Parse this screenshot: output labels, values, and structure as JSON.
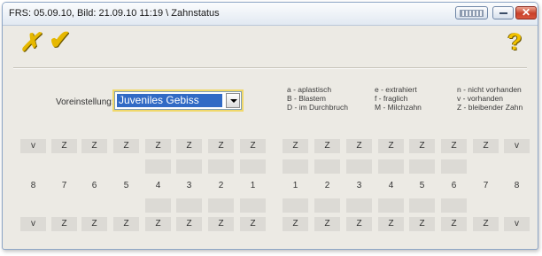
{
  "window": {
    "title": "FRS: 05.09.10,  Bild: 21.09.10  11:19 \\ Zahnstatus",
    "close_glyph": "✕"
  },
  "toolbar": {
    "cancel_icon": "✗",
    "ok_icon": "✔",
    "help_icon": "?"
  },
  "preset": {
    "label": "Voreinstellung:",
    "value": "Juveniles Gebiss"
  },
  "legend": {
    "col1": [
      "a - aplastisch",
      "B - Blastem",
      "D - im Durchbruch"
    ],
    "col2": [
      "e  - extrahiert",
      "f  - fraglich",
      "M - Milchzahn"
    ],
    "col3": [
      "n - nicht vorhanden",
      "v - vorhanden",
      "Z - bleibender Zahn"
    ]
  },
  "chart": {
    "upper_status": [
      "v",
      "Z",
      "Z",
      "Z",
      "Z",
      "Z",
      "Z",
      "Z",
      "Z",
      "Z",
      "Z",
      "Z",
      "Z",
      "Z",
      "Z",
      "v"
    ],
    "lower_status": [
      "v",
      "Z",
      "Z",
      "Z",
      "Z",
      "Z",
      "Z",
      "Z",
      "Z",
      "Z",
      "Z",
      "Z",
      "Z",
      "Z",
      "Z",
      "v"
    ],
    "tooth_numbers": [
      "8",
      "7",
      "6",
      "5",
      "4",
      "3",
      "2",
      "1",
      "1",
      "2",
      "3",
      "4",
      "5",
      "6",
      "7",
      "8"
    ]
  }
}
